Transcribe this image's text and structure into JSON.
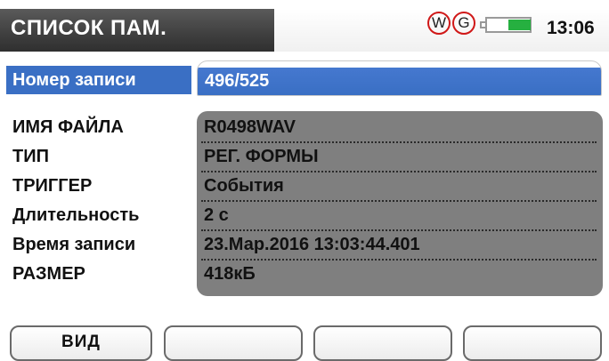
{
  "header": {
    "title": "СПИСОК ПАМ.",
    "badge_w": "W",
    "badge_g": "G",
    "battery_icon": "battery-icon",
    "battery_level": 0.55,
    "time": "13:06"
  },
  "record": {
    "label": "Номер записи",
    "value": "496/525"
  },
  "fields": [
    {
      "label": "ИМЯ ФАЙЛА",
      "value": "R0498WAV"
    },
    {
      "label": "ТИП",
      "value": "РЕГ. ФОРМЫ"
    },
    {
      "label": "ТРИГГЕР",
      "value": "События"
    },
    {
      "label": "Длительность",
      "value": "2 с"
    },
    {
      "label": "Время записи",
      "value": "23.Мар.2016 13:03:44.401"
    },
    {
      "label": "РАЗМЕР",
      "value": "418кБ"
    }
  ],
  "softkeys": [
    {
      "label": "ВИД"
    },
    {
      "label": ""
    },
    {
      "label": ""
    },
    {
      "label": ""
    }
  ],
  "colors": {
    "accent": "#3a6fc4",
    "panel": "#7f7f7f",
    "title_bar": "#444444",
    "badge_ring": "#d01818",
    "battery_fill": "#26b040"
  }
}
